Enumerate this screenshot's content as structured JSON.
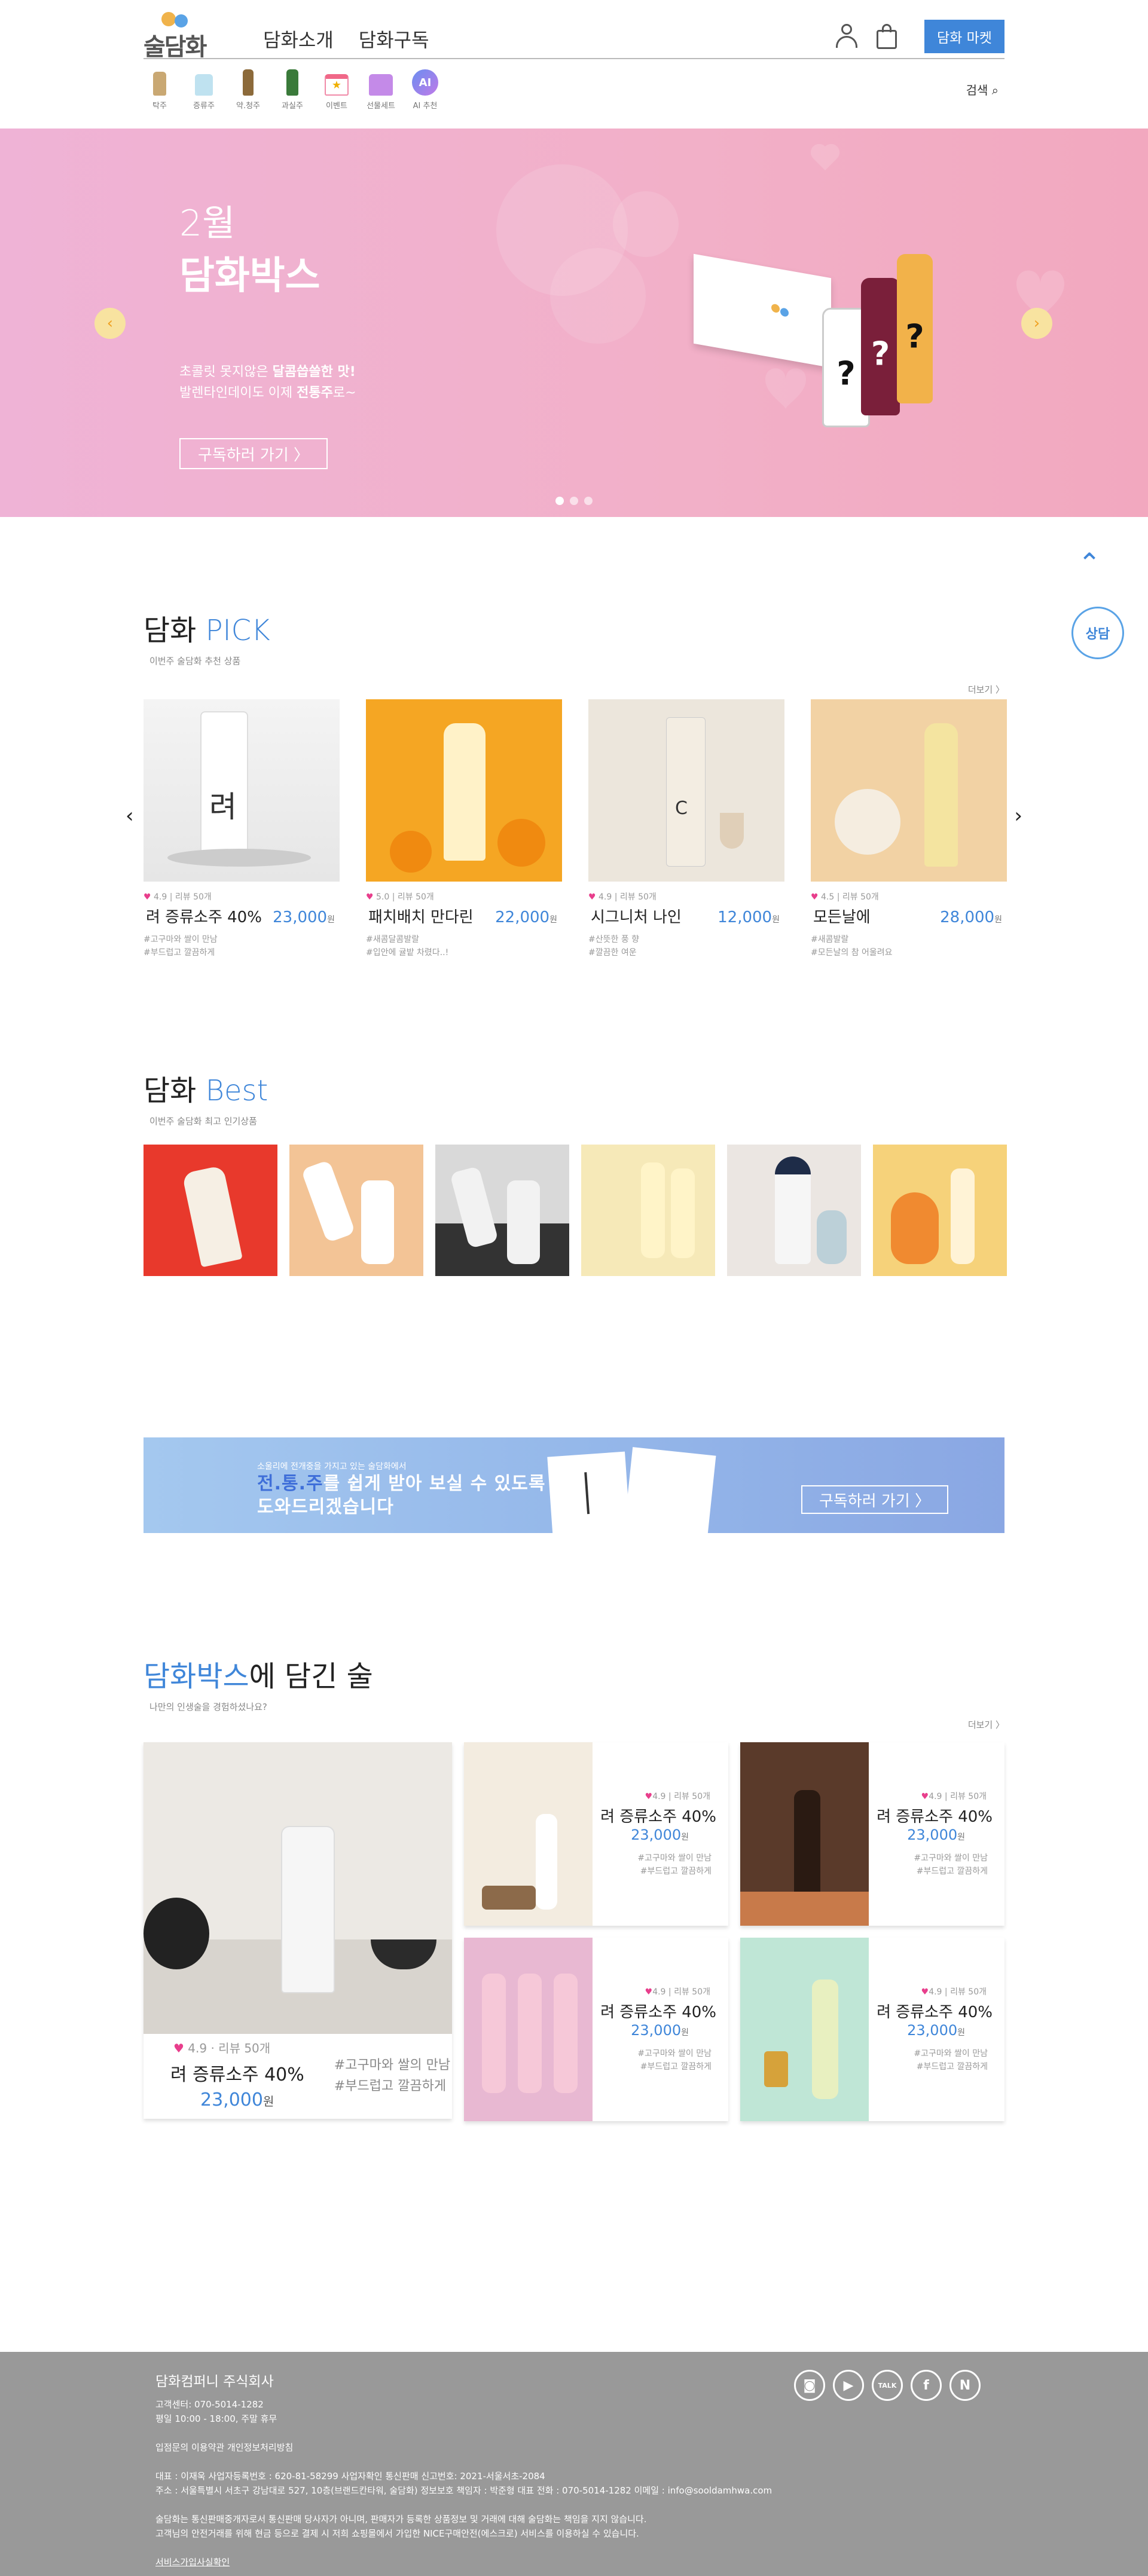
{
  "header": {
    "nav": [
      "담화소개",
      "담화구독"
    ],
    "market_button": "담화 마켓",
    "search_label": "검색",
    "categories": [
      "탁주",
      "증류주",
      "약.청주",
      "과실주",
      "이벤트",
      "선물세트",
      "AI 추천"
    ]
  },
  "hero": {
    "month": "2월",
    "title": "담화박스",
    "desc_line1_pre": "초콜릿 못지않은 ",
    "desc_line1_bold": "달콤씁쓸한 맛!",
    "desc_line2_pre": "발렌타인데이도 이제 ",
    "desc_line2_bold": "전통주",
    "desc_line2_post": "로~",
    "cta": "구독하러 가기 〉",
    "bottle_mark": "?"
  },
  "side": {
    "consult": "상담"
  },
  "pick": {
    "title_pre": "담화 ",
    "title_em": "PICK",
    "subtitle": "이번주 술담화 추천 상품",
    "more": "더보기 〉",
    "products": [
      {
        "rating": "4.9 | 리뷰 50개",
        "name": "려 증류소주 40%",
        "price": "23,000",
        "unit": "원",
        "tags": [
          "#고구마와 쌀이 만남",
          "#부드럽고 깔끔하게"
        ]
      },
      {
        "rating": "5.0 | 리뷰 50개",
        "name": "패치배치 만다린",
        "price": "22,000",
        "unit": "원",
        "tags": [
          "#새콤달콤발랄",
          "#입안에 귤밭 차렸다..!"
        ]
      },
      {
        "rating": "4.9 | 리뷰 50개",
        "name": "시그니처 나인",
        "price": "12,000",
        "unit": "원",
        "tags": [
          "#산뜻한 풍 향",
          "#깔끔한 여운"
        ]
      },
      {
        "rating": "4.5 | 리뷰 50개",
        "name": "모든날에",
        "price": "28,000",
        "unit": "원",
        "tags": [
          "#새콤발랄",
          "#모든날의 참 어울려요"
        ]
      }
    ]
  },
  "best": {
    "title_pre": "담화 ",
    "title_em": "Best",
    "subtitle": "이번주 술담화 최고 인기상품"
  },
  "banner": {
    "small": "소울리에 전개중을 가지고 있는 술담화에서",
    "big_hl": "전.통.주",
    "big_rest": "를 쉽게 받아 보실 수 있도록",
    "big_line2": "도와드리겠습니다",
    "cta": "구독하러 가기 〉"
  },
  "dambox": {
    "title_em": "담화박스",
    "title_rest": "에 담긴 술",
    "subtitle": "나만의 인생술을 경험하셨나요?",
    "more": "더보기 〉",
    "big": {
      "rating": "4.9 · 리뷰 50개",
      "name": "려 증류소주 40%",
      "price": "23,000",
      "unit": "원",
      "tags": [
        "#고구마와 쌀의 만남",
        "#부드럽고 깔끔하게"
      ]
    },
    "items": [
      {
        "rating": "4.9 | 리뷰 50개",
        "name": "려 증류소주 40%",
        "price": "23,000",
        "unit": "원",
        "tags": [
          "#고구마와 쌀이 만남",
          "#부드럽고 깔끔하게"
        ]
      },
      {
        "rating": "4.9 | 리뷰 50개",
        "name": "려 증류소주 40%",
        "price": "23,000",
        "unit": "원",
        "tags": [
          "#고구마와 쌀이 만남",
          "#부드럽고 깔끔하게"
        ]
      },
      {
        "rating": "4.9 | 리뷰 50개",
        "name": "려 증류소주 40%",
        "price": "23,000",
        "unit": "원",
        "tags": [
          "#고구마와 쌀이 만남",
          "#부드럽고 깔끔하게"
        ]
      },
      {
        "rating": "4.9 | 리뷰 50개",
        "name": "려 증류소주 40%",
        "price": "23,000",
        "unit": "원",
        "tags": [
          "#고구마와 쌀이 만남",
          "#부드럽고 깔끔하게"
        ]
      }
    ]
  },
  "footer": {
    "company": "담화컴퍼니 주식회사",
    "cs_phone": "고객센터: 070-5014-1282",
    "cs_hours": "평일 10:00 - 18:00, 주말 휴무",
    "links": "입점문의   이용약관   개인정보처리방침",
    "biz": "대표 : 이재욱    사업자등록번호 : 620-81-58299    사업자확인    통신판매 신고번호: 2021-서울서초-2084",
    "addr": "주소 : 서울특별시 서초구 강남대로 527, 10층(브랜드칸타워, 술담화)     정보보호 책임자 : 박준형     대표 전화 : 070-5014-1282     이메일 : info@sooldamhwa.com",
    "notice1": "술담화는 통신판매중개자로서 통신판매 당사자가 아니며, 판매자가 등록한 상품정보 및 거래에 대해 술담화는 책임을 지지 않습니다.",
    "notice2": "고객님의 안전거래를 위해 현금 등으로 결제 시 저희 쇼핑몰에서 가입한 NICE구매안전(에스크로) 서비스를 이용하실 수 있습니다.",
    "escrow": "서비스가입사실확인",
    "sns": [
      "◙",
      "▶",
      "TALK",
      "f",
      "N"
    ]
  },
  "colors": {
    "accent": "#3f86d9",
    "hero_pink": "#f0b0cc",
    "footer": "#999999"
  }
}
